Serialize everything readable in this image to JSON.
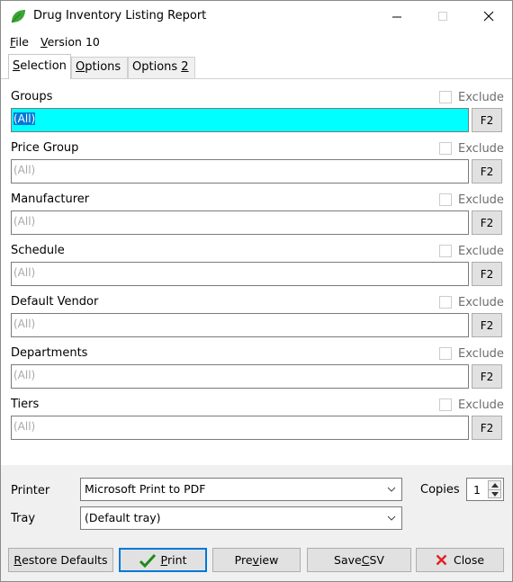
{
  "window": {
    "title": "Drug Inventory Listing Report",
    "minimize_glyph": "—",
    "close_glyph": "✕"
  },
  "menu": {
    "file_mnemonic": "F",
    "file_rest": "ile",
    "version_mnemonic": "V",
    "version_rest": "ersion 10"
  },
  "tabs": {
    "selection_mnemonic": "S",
    "selection_rest": "election",
    "options_mnemonic": "O",
    "options_rest": "ptions",
    "options2_text": "Options ",
    "options2_mnemonic": "2"
  },
  "fields": [
    {
      "label": "Groups",
      "value": "(All)",
      "exclude_label": "Exclude",
      "button": "F2",
      "active": true
    },
    {
      "label": "Price Group",
      "value": "(All)",
      "exclude_label": "Exclude",
      "button": "F2"
    },
    {
      "label": "Manufacturer",
      "value": "(All)",
      "exclude_label": "Exclude",
      "button": "F2"
    },
    {
      "label": "Schedule",
      "value": "(All)",
      "exclude_label": "Exclude",
      "button": "F2"
    },
    {
      "label": "Default Vendor",
      "value": "(All)",
      "exclude_label": "Exclude",
      "button": "F2"
    },
    {
      "label": "Departments",
      "value": "(All)",
      "exclude_label": "Exclude",
      "button": "F2"
    },
    {
      "label": "Tiers",
      "value": "(All)",
      "exclude_label": "Exclude",
      "button": "F2"
    }
  ],
  "printer": {
    "label": "Printer",
    "value": "Microsoft Print to PDF",
    "tray_label": "Tray",
    "tray_value": "(Default tray)",
    "copies_label": "Copies",
    "copies_value": "1"
  },
  "buttons": {
    "restore_mnemonic": "R",
    "restore_rest": "estore Defaults",
    "print_mnemonic": "P",
    "print_rest": "rint",
    "preview_a": "Pre",
    "preview_mnemonic": "v",
    "preview_b": "iew",
    "savecsv_a": "Save ",
    "savecsv_mnemonic": "C",
    "savecsv_b": "SV",
    "close_label": "Close"
  },
  "colors": {
    "active_field_bg": "#00ffff",
    "selection_highlight": "#0078d7",
    "leaf_green": "#3aa635",
    "check_green": "#1e8a1e",
    "close_x_red": "#e02020"
  }
}
